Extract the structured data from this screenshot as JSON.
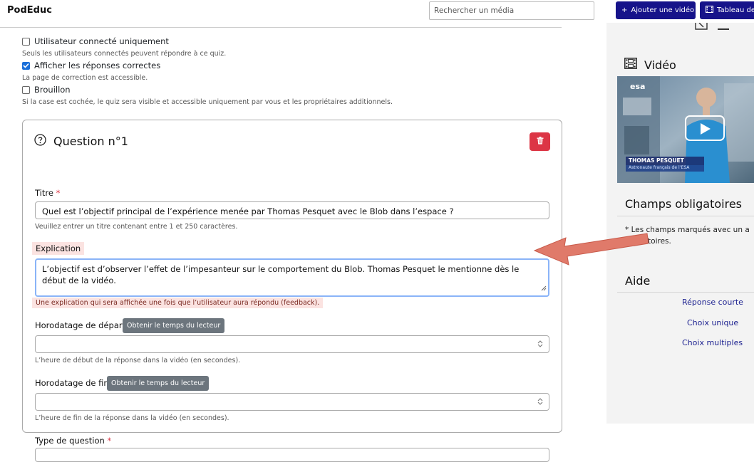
{
  "navbar": {
    "brand": "PodEduc",
    "search_placeholder": "Rechercher un média",
    "add_video_label": "Ajouter une vidéo",
    "dashboard_label": "Tableau de"
  },
  "options": [
    {
      "label": "Utilisateur connecté uniquement",
      "checked": false,
      "help": "Seuls les utilisateurs connectés peuvent répondre à ce quiz."
    },
    {
      "label": "Afficher les réponses correctes",
      "checked": true,
      "help": "La page de correction est accessible."
    },
    {
      "label": "Brouillon",
      "checked": false,
      "help": "Si la case est cochée, le quiz sera visible et accessible uniquement par vous et les propriétaires additionnels."
    }
  ],
  "question": {
    "heading": "Question n°1",
    "title_label": "Titre",
    "required_mark": "*",
    "title_value": "Quel est l’objectif principal de l’expérience menée par Thomas Pesquet avec le Blob dans l’espace ?",
    "title_help": "Veuillez entrer un titre contenant entre 1 et 250 caractères.",
    "explanation_label": "Explication",
    "explanation_value": "L’objectif est d’observer l’effet de l’impesanteur sur le comportement du Blob. Thomas Pesquet le mentionne dès le début de la vidéo.",
    "explanation_help": "Une explication qui sera affichée une fois que l’utilisateur aura répondu (feedback).",
    "start_label": "Horodatage de départ",
    "get_time_label": "Obtenir le temps du lecteur",
    "start_help": "L’heure de début de la réponse dans la vidéo (en secondes).",
    "end_label": "Horodatage de fin",
    "end_help": "L’heure de fin de la réponse dans la vidéo (en secondes).",
    "type_label": "Type de question"
  },
  "sidebar": {
    "video_title": "Vidéo",
    "thumb_name": "THOMAS PESQUET",
    "thumb_role": "Astronaute français de l’ESA",
    "thumb_logo": "esa",
    "required_title": "Champs obligatoires",
    "required_text": "* Les champs marqués avec un a obligatoires.",
    "help_title": "Aide",
    "help_links": [
      "Réponse courte",
      "Choix unique",
      "Choix multiples"
    ]
  },
  "colors": {
    "primary": "#16138a",
    "danger": "#dc3545",
    "secondary": "#6c757d",
    "highlight": "#fbe3e1",
    "arrow": "#e07a6a",
    "focus": "#8ab4f8"
  }
}
